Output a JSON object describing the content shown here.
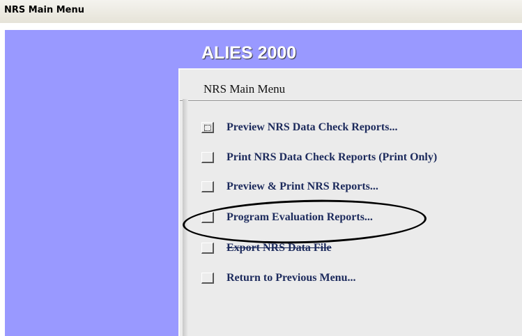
{
  "window": {
    "title": "NRS Main Menu"
  },
  "app": {
    "name": "ALIES 2000"
  },
  "menu": {
    "title": "NRS Main Menu",
    "items": [
      {
        "label": "Preview NRS Data Check Reports..."
      },
      {
        "label": "Print NRS Data Check Reports (Print Only)"
      },
      {
        "label": "Preview & Print NRS Reports..."
      },
      {
        "label": "Program Evaluation Reports..."
      },
      {
        "label": "Export NRS Data File"
      },
      {
        "label": "Return to Previous Menu..."
      }
    ]
  },
  "colors": {
    "background": "#9999ff",
    "panel": "#ebebeb",
    "label": "#1c2a5c",
    "annotation": "#000000"
  }
}
